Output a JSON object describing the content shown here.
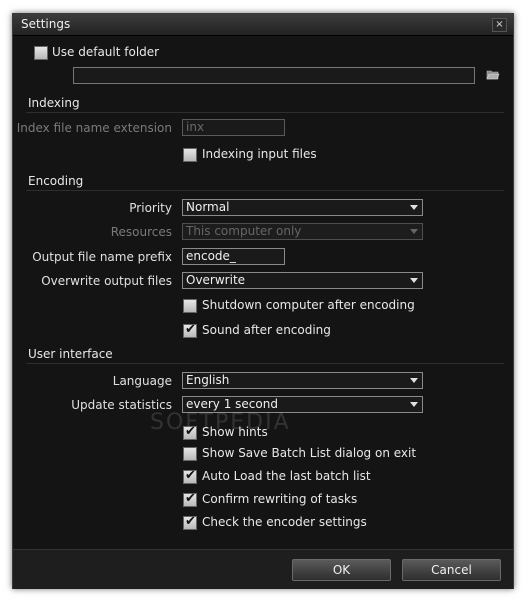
{
  "window": {
    "title": "Settings",
    "close_glyph": "×"
  },
  "general": {
    "use_default_folder": {
      "label": "Use default folder",
      "checked": false
    },
    "folder_path": {
      "value": ""
    },
    "browse_icon": "folder-open-icon"
  },
  "indexing": {
    "title": "Indexing",
    "extension": {
      "label": "Index file name extension",
      "value": "inx",
      "enabled": false
    },
    "indexing_input_files": {
      "label": "Indexing input files",
      "checked": false
    }
  },
  "encoding": {
    "title": "Encoding",
    "priority": {
      "label": "Priority",
      "value": "Normal"
    },
    "resources": {
      "label": "Resources",
      "value": "This computer only",
      "enabled": false
    },
    "output_prefix": {
      "label": "Output file name prefix",
      "value": "encode_"
    },
    "overwrite": {
      "label": "Overwrite output files",
      "value": "Overwrite"
    },
    "shutdown": {
      "label": "Shutdown computer after encoding",
      "checked": false
    },
    "sound": {
      "label": "Sound after encoding",
      "checked": true
    }
  },
  "ui": {
    "title": "User interface",
    "language": {
      "label": "Language",
      "value": "English"
    },
    "update_statistics": {
      "label": "Update statistics",
      "value": "every 1 second"
    },
    "show_hints": {
      "label": "Show hints",
      "checked": true
    },
    "save_batch_dialog": {
      "label": "Show Save Batch List dialog on exit",
      "checked": false
    },
    "auto_load": {
      "label": "Auto Load the last batch list",
      "checked": true
    },
    "confirm_rewrite": {
      "label": "Confirm rewriting of tasks",
      "checked": true
    },
    "check_encoder": {
      "label": "Check the encoder settings",
      "checked": true
    }
  },
  "footer": {
    "ok_label": "OK",
    "cancel_label": "Cancel"
  },
  "watermark": "SOFTPEDIA",
  "colors": {
    "window_bg": "#141414",
    "text": "#e8e8e8",
    "disabled_text": "#7a7a7a"
  }
}
